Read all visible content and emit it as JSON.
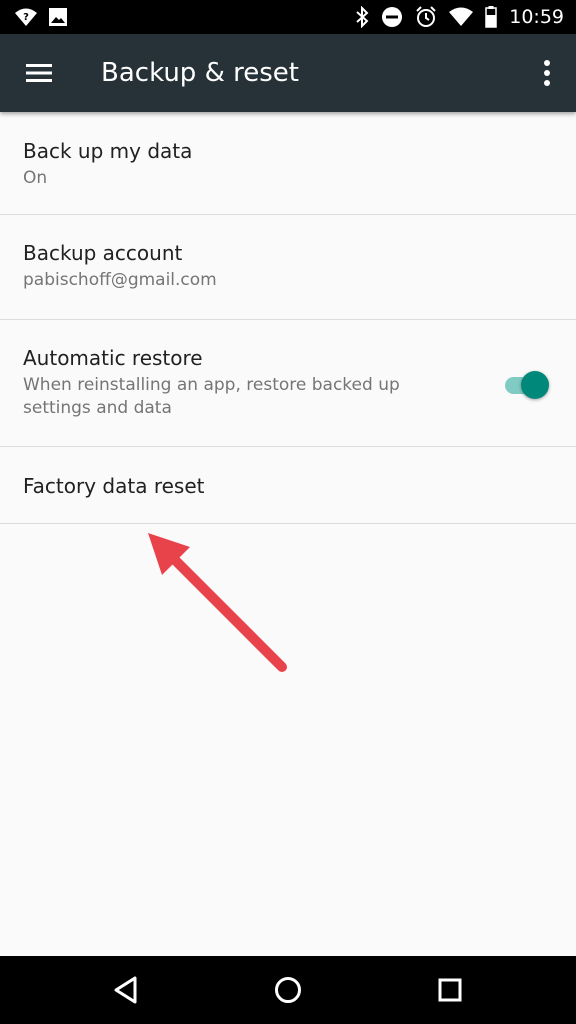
{
  "status_bar": {
    "time": "10:59",
    "icons": [
      "signal-question-icon",
      "image-icon",
      "bluetooth-icon",
      "do-not-disturb-icon",
      "alarm-icon",
      "wifi-icon",
      "battery-icon"
    ]
  },
  "app_bar": {
    "title": "Backup & reset",
    "menu_icon": "hamburger-menu-icon",
    "overflow_icon": "more-vert-icon"
  },
  "settings": {
    "back_up_data": {
      "title": "Back up my data",
      "summary": "On"
    },
    "backup_account": {
      "title": "Backup account",
      "summary": "pabischoff@gmail.com"
    },
    "automatic_restore": {
      "title": "Automatic restore",
      "summary_line1": "When reinstalling an app, restore backed up",
      "summary_line2": "settings and data",
      "enabled": true
    },
    "factory_reset": {
      "title": "Factory data reset"
    }
  },
  "colors": {
    "app_bar": "#263238",
    "toggle_thumb": "#00897b",
    "toggle_track": "#80cbc4",
    "annotation_arrow": "#e8434a"
  },
  "nav_bar": {
    "icons": [
      "back-icon",
      "home-icon",
      "recents-icon"
    ]
  }
}
